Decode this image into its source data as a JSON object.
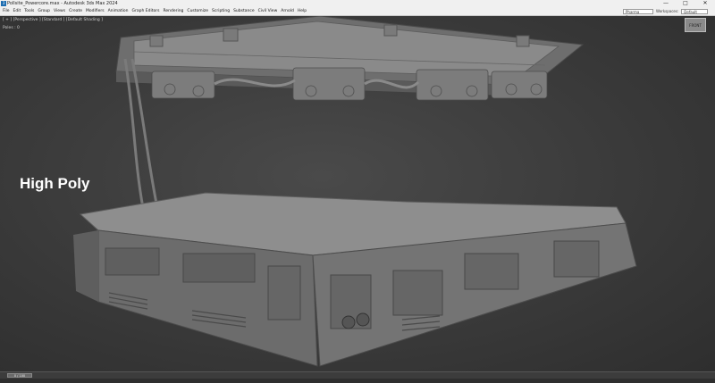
{
  "window": {
    "title": "Pollsite_Powercore.max - Autodesk 3ds Max 2024",
    "app_icon": "3ds-max-icon",
    "controls": [
      "—",
      "□",
      "✕"
    ]
  },
  "menu": {
    "items": [
      "File",
      "Edit",
      "Tools",
      "Group",
      "Views",
      "Create",
      "Modifiers",
      "Animation",
      "Graph Editors",
      "Rendering",
      "Customize",
      "Scripting",
      "Substance",
      "Civil View",
      "Arnold",
      "Help"
    ],
    "search_value": "Pharma Sound...",
    "workspaces_label": "Workspaces:",
    "workspaces_value": "Default"
  },
  "viewport": {
    "label": "[ + ] [Perspective ] [Standard ] [Default Shading ]",
    "stat": "Poles : 0",
    "viewcube_label": "FRONT",
    "overlay_text": "High Poly"
  },
  "timeline": {
    "slider_label": "0 / 100"
  },
  "colors": {
    "model": "#8c8c8c",
    "viewport_bg": "#3a3a3a"
  }
}
